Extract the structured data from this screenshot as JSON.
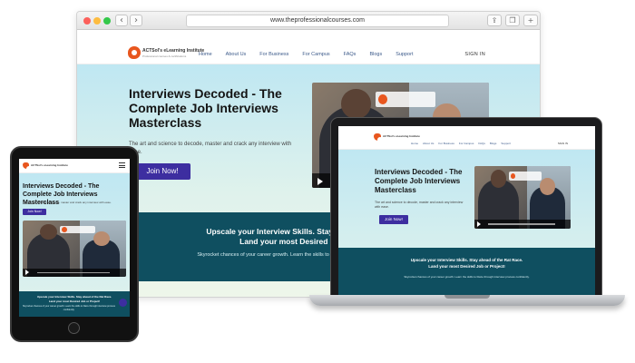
{
  "browser": {
    "url": "www.theprofessionalcourses.com",
    "icons": [
      "share-icon",
      "tabs-icon",
      "plus-icon"
    ]
  },
  "site": {
    "logo": {
      "name": "ACTSol's eLearning Institute",
      "tagline": "Professional courses & certifications"
    },
    "menu": [
      "Home",
      "About Us",
      "For Business",
      "For Campus",
      "FAQs",
      "Blogs",
      "Support"
    ],
    "signin": "SIGN IN",
    "hero": {
      "title": "Interviews Decoded - The Complete Job Interviews Masterclass",
      "description": "The art and science to decode, master and crack any interview with ease.",
      "cta": "Join Now!"
    },
    "banner": {
      "heading_line1": "Upscale your Interview Skills. Stay ahead of the Rat Race.",
      "heading_line2": "Land your most Desired Job or Project!",
      "text": "Skyrocket chances of your career growth. Learn the skills to blaze through interview process confidently."
    }
  },
  "colors": {
    "accent_button": "#3d2ea0",
    "banner_teal": "#0f4f60",
    "logo_orange": "#e8561e",
    "menu_link": "#3c5a8a"
  }
}
